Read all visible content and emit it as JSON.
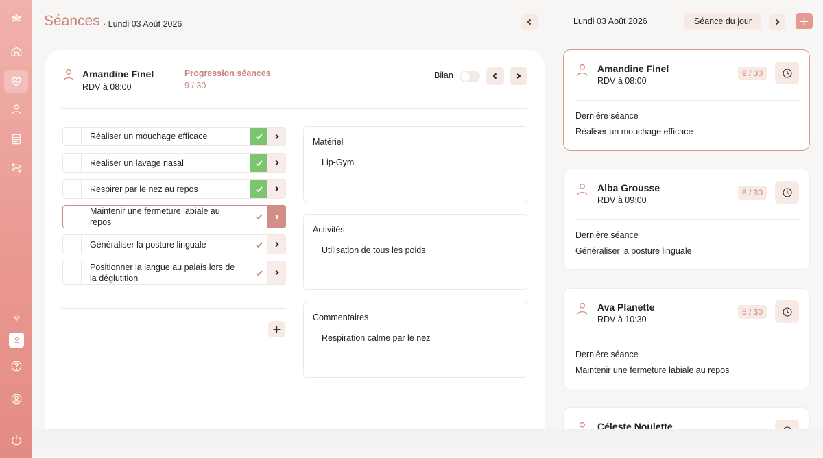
{
  "header": {
    "title": "Séances",
    "subtitle": "· Lundi 03 Août 2026",
    "current_date": "Lundi 03 Août 2026",
    "today_button": "Séance du jour",
    "add_button": "+"
  },
  "sidebar": {
    "items": [
      {
        "icon": "lotus-logo-icon"
      },
      {
        "icon": "home-icon"
      },
      {
        "icon": "heart-pulse-icon",
        "active": true
      },
      {
        "icon": "user-icon"
      },
      {
        "icon": "document-icon"
      },
      {
        "icon": "route-icon"
      },
      {
        "icon": "settings-icon"
      },
      {
        "icon": "user-chip-icon"
      },
      {
        "icon": "help-icon"
      },
      {
        "icon": "account-icon"
      },
      {
        "icon": "power-icon"
      }
    ]
  },
  "session": {
    "patient_name": "Amandine Finel",
    "rdv": "RDV à 08:00",
    "progress_label": "Progression séances",
    "progress_value": "9 / 30",
    "bilan_label": "Bilan",
    "bilan_enabled": false,
    "objectives": [
      {
        "label": "Réaliser un mouchage efficace",
        "done": true
      },
      {
        "label": "Réaliser un lavage nasal",
        "done": true
      },
      {
        "label": "Respirer par le nez au repos",
        "done": true
      },
      {
        "label": "Maintenir une fermeture labiale au repos",
        "done": false,
        "selected": true
      },
      {
        "label": "Généraliser la posture linguale",
        "done": false
      },
      {
        "label": "Positionner la langue au palais lors de la déglutition",
        "done": false
      }
    ],
    "add_objective": "+",
    "materiel_title": "Matériel",
    "materiel_value": "Lip-Gym",
    "activites_title": "Activités",
    "activites_value": "Utilisation de tous les poids",
    "commentaires_title": "Commentaires",
    "commentaires_value": "Respiration calme par le nez"
  },
  "patients": [
    {
      "name": "Amandine Finel",
      "rdv": "RDV à 08:00",
      "progress": "9 / 30",
      "last_label": "Dernière séance",
      "last": "Réaliser un mouchage efficace",
      "active": true
    },
    {
      "name": "Alba Grousse",
      "rdv": "RDV à 09:00",
      "progress": "6 / 30",
      "last_label": "Dernière séance",
      "last": "Généraliser la posture linguale"
    },
    {
      "name": "Ava Planette",
      "rdv": "RDV à 10:30",
      "progress": "5 / 30",
      "last_label": "Dernière séance",
      "last": "Maintenir une fermeture labiale au repos"
    },
    {
      "name": "Céleste Noulette",
      "rdv": "",
      "progress": "",
      "last_label": "",
      "last": ""
    }
  ],
  "colors": {
    "accent": "#c9867d",
    "sidebar_top": "#f0b2ab",
    "sidebar_bottom": "#e38c84",
    "done_green": "#7cc46f",
    "soft_button": "#f7e9e3"
  }
}
